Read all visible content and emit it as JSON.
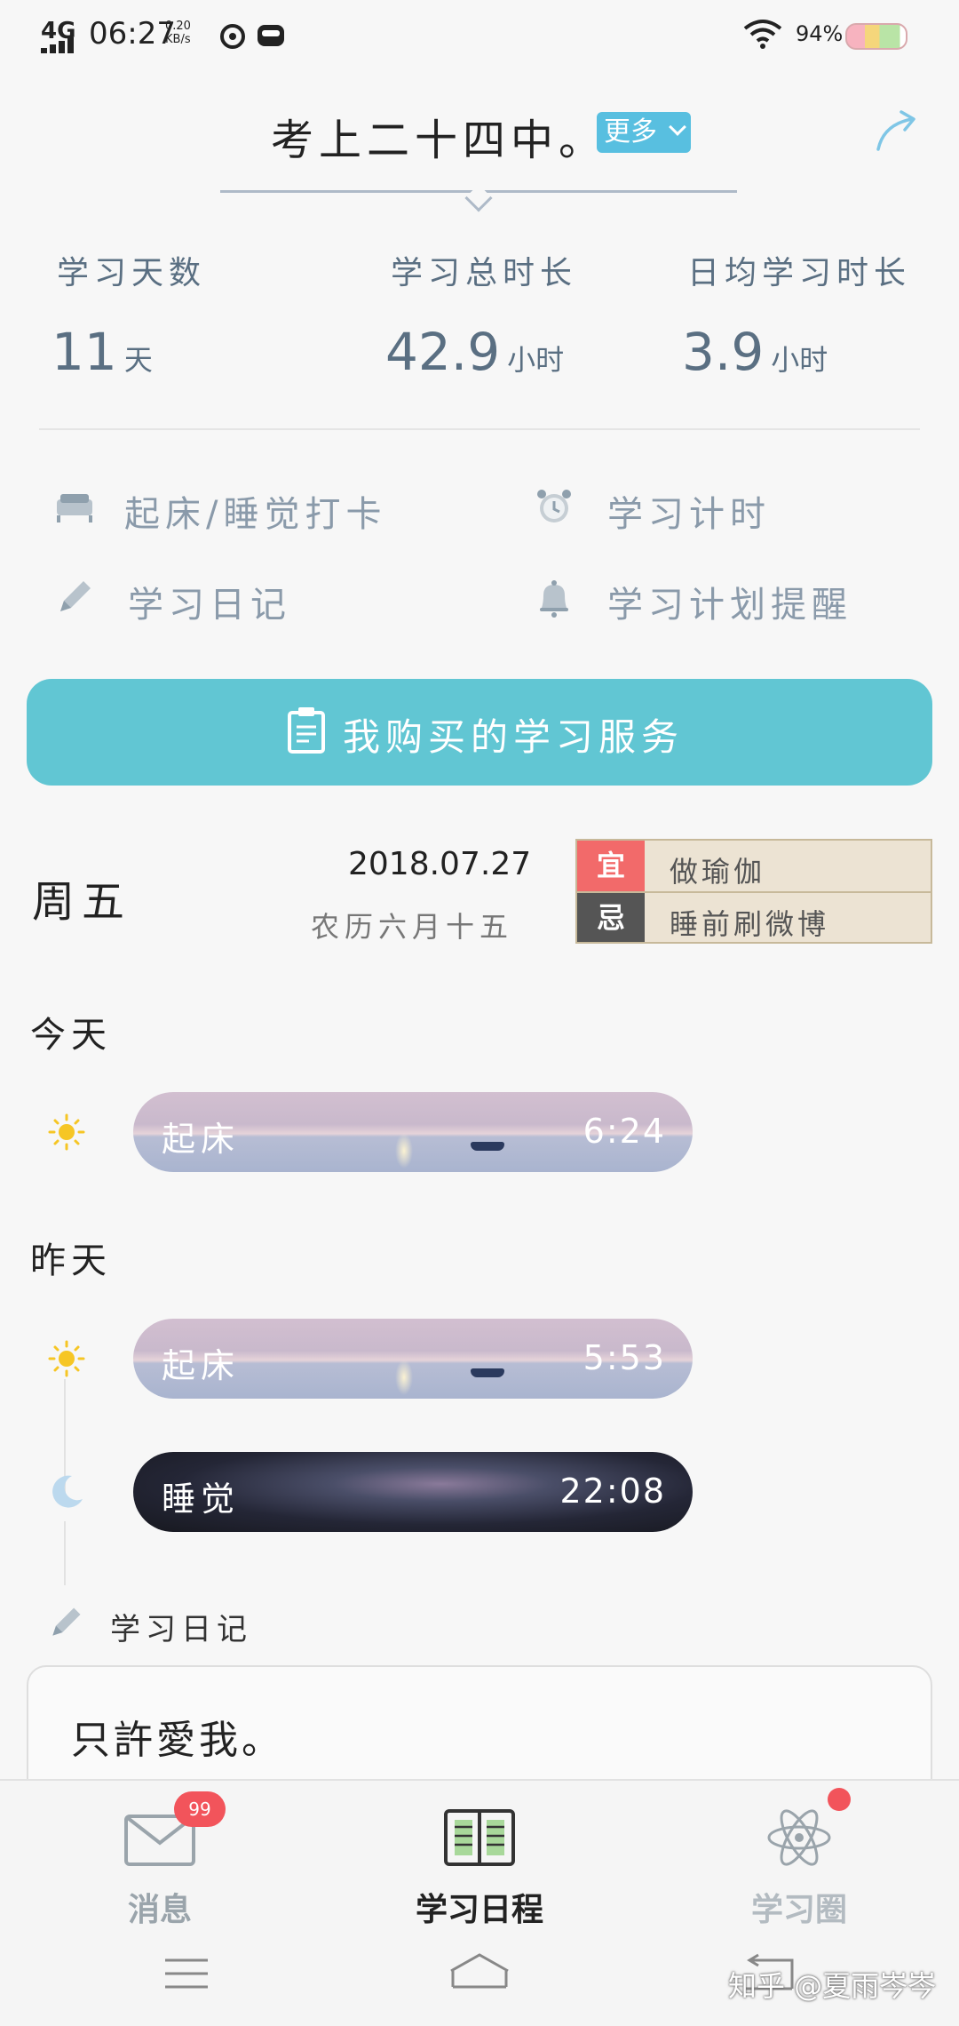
{
  "status_bar": {
    "network": "4G",
    "time": "06:27",
    "speed_value": "0.20",
    "speed_unit": "KB/s",
    "battery": "94%"
  },
  "header": {
    "title": "考上二十四中。",
    "more_label": "更多",
    "share_icon": "share-arrow-icon"
  },
  "stats": [
    {
      "label": "学习天数",
      "value": "11",
      "unit": "天"
    },
    {
      "label": "学习总时长",
      "value": "42.9",
      "unit": "小时"
    },
    {
      "label": "日均学习时长",
      "value": "3.9",
      "unit": "小时"
    }
  ],
  "quick_actions": [
    {
      "label": "起床/睡觉打卡",
      "icon": "bed-icon"
    },
    {
      "label": "学习计时",
      "icon": "alarm-clock-icon"
    },
    {
      "label": "学习日记",
      "icon": "pencil-icon"
    },
    {
      "label": "学习计划提醒",
      "icon": "bell-icon"
    }
  ],
  "service_button": {
    "label": "我购买的学习服务",
    "icon": "document-icon"
  },
  "date_info": {
    "weekday": "周五",
    "date": "2018.07.27",
    "lunar": "农历六月十五",
    "almanac": [
      {
        "tag": "宜",
        "text": "做瑜伽",
        "color": "#f26a6a"
      },
      {
        "tag": "忌",
        "text": "睡前刷微博",
        "color": "#555555"
      }
    ]
  },
  "timeline": {
    "today_label": "今天",
    "today": [
      {
        "label": "起床",
        "time": "6:24",
        "icon": "sun-icon"
      }
    ],
    "yesterday_label": "昨天",
    "yesterday": [
      {
        "label": "起床",
        "time": "5:53",
        "icon": "sun-icon"
      },
      {
        "label": "睡觉",
        "time": "22:08",
        "icon": "moon-icon"
      }
    ]
  },
  "diary": {
    "heading": "学习日记",
    "text": "只許愛我。"
  },
  "bottom_nav": {
    "items": [
      {
        "label": "消息",
        "badge": "99",
        "active": false
      },
      {
        "label": "学习日程",
        "active": true
      },
      {
        "label": "学习圈",
        "active": false
      }
    ]
  },
  "watermark": "知乎 @夏雨岑岑",
  "colors": {
    "accent": "#61c6d3",
    "more_button": "#58bfe0",
    "badge": "#f2545b",
    "stat_text": "#5a6f82"
  }
}
